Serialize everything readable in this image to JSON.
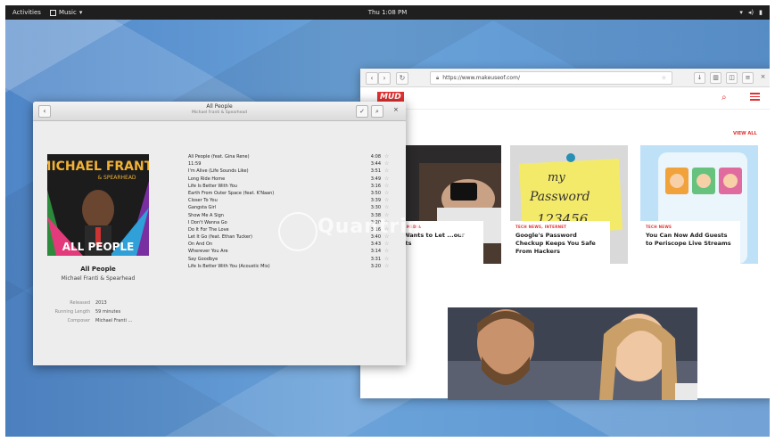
{
  "topbar": {
    "activities": "Activities",
    "app_menu": "Music",
    "clock": "Thu 1:08 PM"
  },
  "browser": {
    "url": "https://www.makeuseof.com/",
    "logo": "MUD",
    "view_all": "VIEW ALL",
    "cards": [
      {
        "category": "SOCIAL MEDIA",
        "title": "...ill Wants to Let ...our Tweets"
      },
      {
        "category": "TECH NEWS, INTERNET",
        "title": "Google's Password Checkup Keeps You Safe From Hackers",
        "note_line1": "my",
        "note_line2": "Password",
        "note_line3": "123456"
      },
      {
        "category": "TECH NEWS",
        "title": "You Can Now Add Guests to Periscope Live Streams"
      }
    ]
  },
  "music": {
    "header_title": "All People",
    "header_subtitle": "Michael Franti & Spearhead",
    "cover_artist": "MICHAEL FRANTI",
    "cover_band": "& SPEARHEAD",
    "cover_album": "ALL PEOPLE",
    "album_title": "All People",
    "album_artist": "Michael Franti & Spearhead",
    "meta": [
      {
        "label": "Released",
        "value": "2013"
      },
      {
        "label": "Running Length",
        "value": "59 minutes"
      },
      {
        "label": "Composer",
        "value": "Michael Franti ..."
      }
    ],
    "tracks": [
      {
        "title": "All People (feat. Gina Rene)",
        "duration": "4:08"
      },
      {
        "title": "11:59",
        "duration": "3:44"
      },
      {
        "title": "I'm Alive (Life Sounds Like)",
        "duration": "3:51"
      },
      {
        "title": "Long Ride Home",
        "duration": "3:49"
      },
      {
        "title": "Life Is Better With You",
        "duration": "3:16"
      },
      {
        "title": "Earth From Outer Space (feat. K'Naan)",
        "duration": "3:50"
      },
      {
        "title": "Closer To You",
        "duration": "3:39"
      },
      {
        "title": "Gangsta Girl",
        "duration": "3:30"
      },
      {
        "title": "Show Me A Sign",
        "duration": "3:38"
      },
      {
        "title": "I Don't Wanna Go",
        "duration": "3:20"
      },
      {
        "title": "Do It For The Love",
        "duration": "3:16"
      },
      {
        "title": "Let It Go (feat. Ethan Tucker)",
        "duration": "3:40"
      },
      {
        "title": "On And On",
        "duration": "3:43"
      },
      {
        "title": "Wherever You Are",
        "duration": "3:14"
      },
      {
        "title": "Say Goodbye",
        "duration": "3:31"
      },
      {
        "title": "Life Is Better With You (Acoustic Mix)",
        "duration": "3:20"
      }
    ]
  },
  "watermark": "Quantrimang",
  "colors": {
    "accent": "#e03131",
    "desktop": "#5b93cf",
    "topbar": "#1f1f1f"
  },
  "icons": {
    "star": "☆",
    "back": "‹",
    "check": "✓",
    "search": "⌕",
    "close": "×"
  }
}
